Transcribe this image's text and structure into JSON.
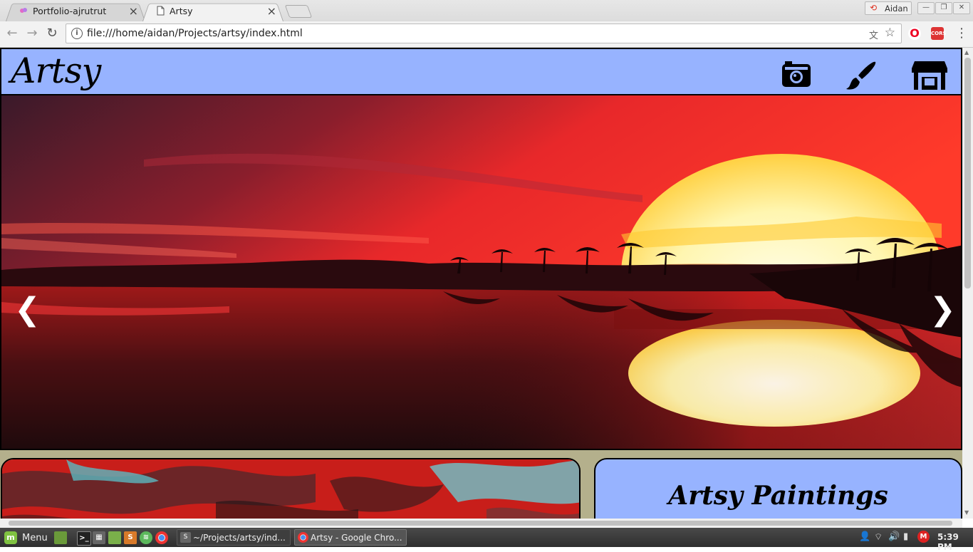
{
  "browser": {
    "tabs": [
      {
        "title": "Portfolio-ajrutrut",
        "active": false
      },
      {
        "title": "Artsy",
        "active": true
      }
    ],
    "profile_name": "Aidan",
    "url": "file:///home/aidan/Projects/artsy/index.html",
    "extensions": {
      "cors_label": "CORS"
    }
  },
  "site": {
    "brand": "Artsy",
    "header_icons": [
      "camera-icon",
      "paintbrush-icon",
      "store-icon"
    ],
    "carousel": {
      "prev": "❮",
      "next": "❯"
    },
    "featured_card_title": "Artsy Paintings",
    "colors": {
      "header_bg": "#97b3ff",
      "page_bg": "#b4b08c"
    }
  },
  "taskbar": {
    "menu_label": "Menu",
    "tasks": [
      {
        "label": "~/Projects/artsy/ind..."
      },
      {
        "label": "Artsy - Google Chro..."
      }
    ],
    "clock": "5:39 PM"
  }
}
